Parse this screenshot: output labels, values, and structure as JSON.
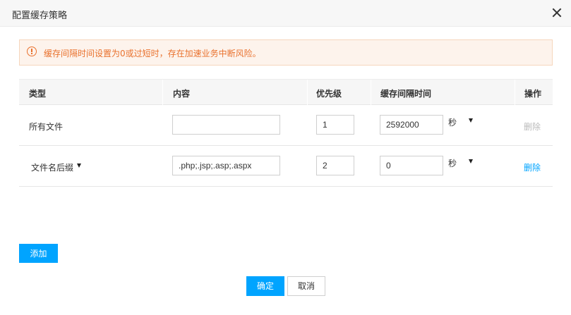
{
  "dialog": {
    "title": "配置缓存策略"
  },
  "alert": {
    "text": "缓存间隔时间设置为0或过短时，存在加速业务中断风险。",
    "color": "#e9712d"
  },
  "table": {
    "headers": {
      "type": "类型",
      "content": "内容",
      "priority": "优先级",
      "interval": "缓存间隔时间",
      "action": "操作"
    },
    "rows": [
      {
        "type": "所有文件",
        "type_is_select": false,
        "content": "",
        "priority": "1",
        "interval": "2592000",
        "unit": "秒",
        "action": "删除",
        "action_enabled": false
      },
      {
        "type": "文件名后缀",
        "type_is_select": true,
        "content": ".php;.jsp;.asp;.aspx",
        "priority": "2",
        "interval": "0",
        "unit": "秒",
        "action": "删除",
        "action_enabled": true
      }
    ]
  },
  "buttons": {
    "add": "添加",
    "confirm": "确定",
    "cancel": "取消"
  },
  "colors": {
    "primary": "#00a4ff",
    "link": "#00a4ff",
    "disabled": "#bbbbbb",
    "warning": "#e9712d"
  }
}
